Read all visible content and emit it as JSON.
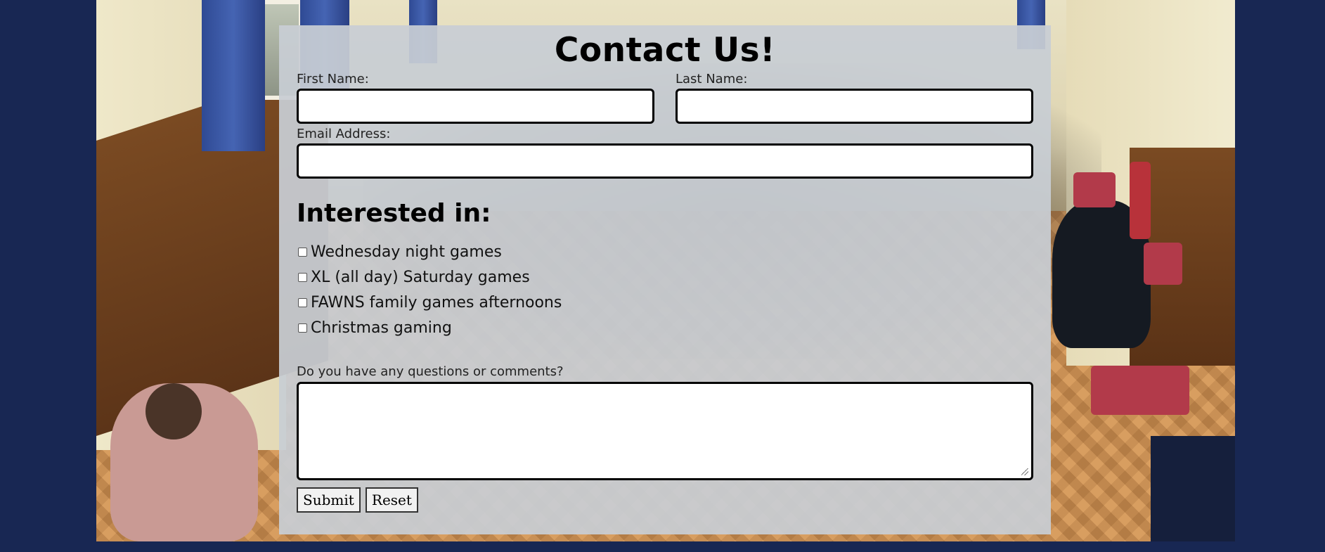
{
  "form": {
    "title": "Contact Us!",
    "first_name_label": "First Name:",
    "last_name_label": "Last Name:",
    "email_label": "Email Address:",
    "first_name_value": "",
    "last_name_value": "",
    "email_value": "",
    "interests_heading": "Interested in:",
    "interests": [
      {
        "label": "Wednesday night games",
        "checked": false
      },
      {
        "label": "XL (all day) Saturday games",
        "checked": false
      },
      {
        "label": "FAWNS family games afternoons",
        "checked": false
      },
      {
        "label": "Christmas gaming",
        "checked": false
      }
    ],
    "comments_label": "Do you have any questions or comments?",
    "comments_value": "",
    "submit_label": "Submit",
    "reset_label": "Reset"
  },
  "colors": {
    "page_background": "#182753",
    "panel_background": "#c8cdd4",
    "input_border": "#000000"
  }
}
